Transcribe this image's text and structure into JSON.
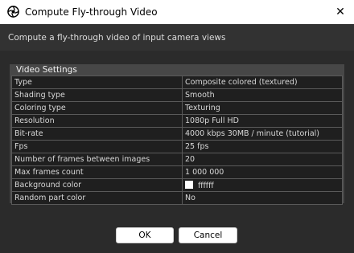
{
  "window": {
    "title": "Compute Fly-through Video",
    "icon": "aperture-icon",
    "close_glyph": "✕"
  },
  "description": "Compute a fly-through video of input camera views",
  "settings": {
    "group_title": "Video Settings",
    "rows": [
      {
        "key": "Type",
        "value": "Composite colored (textured)"
      },
      {
        "key": "Shading type",
        "value": "Smooth"
      },
      {
        "key": "Coloring type",
        "value": "Texturing"
      },
      {
        "key": "Resolution",
        "value": "1080p Full HD"
      },
      {
        "key": "Bit-rate",
        "value": "4000 kbps 30MB / minute (tutorial)"
      },
      {
        "key": "Fps",
        "value": "25 fps"
      },
      {
        "key": "Number of frames between images",
        "value": "20"
      },
      {
        "key": "Max frames count",
        "value": "1 000 000"
      },
      {
        "key": "Background color",
        "value": "ffffff",
        "swatch": "#ffffff"
      },
      {
        "key": "Random part color",
        "value": "No"
      }
    ]
  },
  "buttons": {
    "ok": "OK",
    "cancel": "Cancel"
  }
}
